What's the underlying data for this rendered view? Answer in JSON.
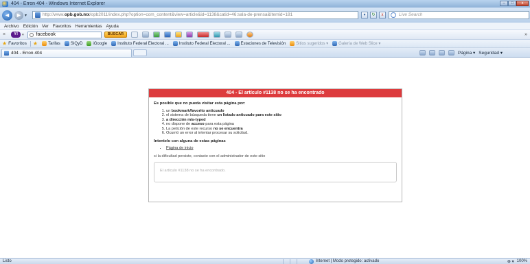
{
  "window": {
    "title": "404 - Erron 404 - Windows Internet Explorer",
    "buttons": [
      "–",
      "□",
      "x"
    ]
  },
  "address": {
    "url_prefix": "http://www.",
    "url_domain": "opb.gob.mx",
    "url_path": "/opb2011/index.php?option=com_content&view=article&id=1138&catid=46:sala-de-prensa&Itemid=181",
    "live_search_placeholder": "Live Search"
  },
  "menu": [
    "Archivo",
    "Edición",
    "Ver",
    "Favoritos",
    "Herramientas",
    "Ayuda"
  ],
  "yahoo_toolbar": {
    "search_value": "facebook",
    "search_button": "BUSCAR"
  },
  "favorites_bar": {
    "label": "Favoritos",
    "items": [
      "Tarifas",
      "SIQyD",
      "iGoogle",
      "Instituto Federal Electoral ...",
      "Instituto Federal Electoral ...",
      "Estaciones de Televisión",
      "Sitios sugeridos ▾",
      "Galería de Web Slice ▾"
    ]
  },
  "tabs": {
    "active": "404 - Erron 404",
    "page_menu": "Página ▾",
    "safety_menu": "Seguridad ▾"
  },
  "error_page": {
    "header": "404 - El artículo #1138 no se ha encontrado",
    "reason_heading": "Es posible que no pueda visitar esta página por:",
    "reasons": [
      {
        "pre": "un ",
        "bold": "bookmark/favorito anticuado",
        "post": ""
      },
      {
        "pre": "el sistema de búsqueda tiene ",
        "bold": "un listado anticuado para este sitio",
        "post": ""
      },
      {
        "pre": "",
        "bold": "a dirección mis-typed",
        "post": ""
      },
      {
        "pre": "no dispone de ",
        "bold": "acceso",
        "post": " para esta página"
      },
      {
        "pre": "La petición de este recurso ",
        "bold": "no se encuentra",
        "post": ""
      },
      {
        "pre": "Ocurrió un error al intentar procesar su solicitud.",
        "bold": "",
        "post": ""
      }
    ],
    "try_heading": "Intentelo con alguna de estas páginas",
    "links": [
      "Página de inicio"
    ],
    "contact_note": "si la dificultad persiste, contacte con el administrador de este sitio",
    "message": "El artículo #1138 no se ha encontrado."
  },
  "status": {
    "left": "Listo",
    "zone": "Internet | Modo protegido: activado",
    "zoom": "100%"
  }
}
